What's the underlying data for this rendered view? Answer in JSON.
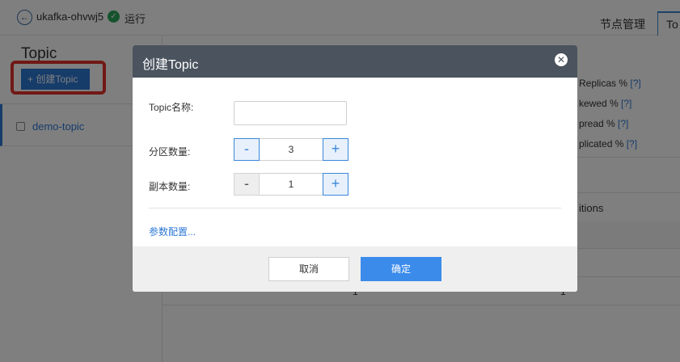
{
  "topbar": {
    "back_icon": "arrow-left-circle-icon",
    "cluster_name": "ukafka-ohvwj5",
    "status_icon": "check-circle-icon",
    "status_color": "#2aa65a",
    "status": "运行",
    "tabs": [
      {
        "label": "节点管理"
      },
      {
        "label": "To"
      }
    ]
  },
  "sidebar": {
    "title": "Topic",
    "create_button": "+ 创建Topic",
    "topics": [
      {
        "name": "demo-topic"
      }
    ]
  },
  "main": {
    "metrics": [
      {
        "label": "Replicas % ",
        "help": "[?]"
      },
      {
        "label": "kewed % ",
        "help": "[?]"
      },
      {
        "label": "pread % ",
        "help": "[?]"
      },
      {
        "label": "plicated % ",
        "help": "[?]"
      }
    ],
    "column_header": "itions",
    "row_values": [
      "1",
      "1"
    ]
  },
  "modal": {
    "title": "创建Topic",
    "close_icon": "close-icon",
    "topic_name_label": "Topic名称:",
    "topic_name_value": "",
    "partition_label": "分区数量:",
    "partition_value": "3",
    "replica_label": "副本数量:",
    "replica_value": "1",
    "minus_label": "-",
    "plus_label": "+",
    "param_link": "参数配置...",
    "cancel": "取消",
    "confirm": "确定"
  },
  "colors": {
    "accent": "#2d78d4",
    "modal_header": "#4a535e",
    "confirm_button": "#3b8beb",
    "highlight_box": "#e3322b"
  }
}
